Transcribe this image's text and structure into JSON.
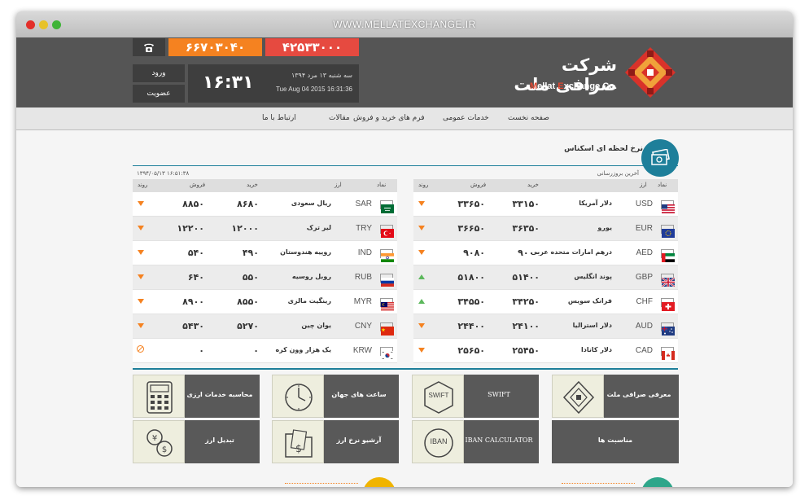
{
  "browser": {
    "url": "WWW.MELLATEXCHANGE.IR"
  },
  "header": {
    "logo_title": "شرکت صرافی ملت",
    "logo_sub_parts": [
      "M",
      "ellat ",
      "E",
      "xchange ",
      "Co."
    ],
    "phone_1": "۶۶۷۰۳۰۴۰",
    "phone_2": "۴۲۵۳۳۰۰۰",
    "login_label": "ورود",
    "signup_label": "عضویت",
    "clock_time": "۱۶:۳۱",
    "date_fa": "سه شنبه ۱۳ مرد ۱۳۹۴",
    "date_en": "Tue Aug 04 2015 16:31:36"
  },
  "menu": {
    "items": [
      "صفحه نخست",
      "خدمات عمومی",
      "فرم های خرید و فروش",
      "مقالات",
      "ارتباط با ما"
    ]
  },
  "rates": {
    "title": "نرخ لحظه ای اسکناس",
    "updated_label": "آخرین بروزرسانی",
    "date_stamp": "۱۳۹۴/۰۵/۱۳ ۱۶:۵۱:۳۸",
    "headers": {
      "symbol": "نماد",
      "currency": "ارز",
      "buy": "خرید",
      "sell": "فروش",
      "trend": "روند"
    },
    "right_rows": [
      {
        "flag": "US",
        "code": "USD",
        "name": "دلار آمریکا",
        "buy": "۳۳۱۵۰",
        "sell": "۳۳۶۵۰",
        "trend": "down"
      },
      {
        "flag": "EU",
        "code": "EUR",
        "name": "یورو",
        "buy": "۳۶۳۵۰",
        "sell": "۳۶۶۵۰",
        "trend": "down"
      },
      {
        "flag": "AE",
        "code": "AED",
        "name": "درهم امارات متحده عربی",
        "buy": "۹۰۰۰",
        "sell": "۹۰۸۰",
        "trend": "down"
      },
      {
        "flag": "GB",
        "code": "GBP",
        "name": "پوند انگلیس",
        "buy": "۵۱۴۰۰",
        "sell": "۵۱۸۰۰",
        "trend": "up"
      },
      {
        "flag": "CH",
        "code": "CHF",
        "name": "فرانک سویس",
        "buy": "۳۴۲۵۰",
        "sell": "۳۴۵۵۰",
        "trend": "up"
      },
      {
        "flag": "AU",
        "code": "AUD",
        "name": "دلار استرالیا",
        "buy": "۲۴۱۰۰",
        "sell": "۲۴۴۰۰",
        "trend": "down"
      },
      {
        "flag": "CA",
        "code": "CAD",
        "name": "دلار کانادا",
        "buy": "۲۵۴۵۰",
        "sell": "۲۵۶۵۰",
        "trend": "down"
      }
    ],
    "left_rows": [
      {
        "flag": "SA",
        "code": "SAR",
        "name": "ریال سعودی",
        "buy": "۸۶۸۰",
        "sell": "۸۸۵۰",
        "trend": "down"
      },
      {
        "flag": "TR",
        "code": "TRY",
        "name": "لیر ترک",
        "buy": "۱۲۰۰۰",
        "sell": "۱۲۲۰۰",
        "trend": "down"
      },
      {
        "flag": "IN",
        "code": "IND",
        "name": "روپیه هندوستان",
        "buy": "۴۹۰",
        "sell": "۵۴۰",
        "trend": "down"
      },
      {
        "flag": "RU",
        "code": "RUB",
        "name": "روبل روسیه",
        "buy": "۵۵۰",
        "sell": "۶۴۰",
        "trend": "down"
      },
      {
        "flag": "MY",
        "code": "MYR",
        "name": "رینگیت مالزی",
        "buy": "۸۵۵۰",
        "sell": "۸۹۰۰",
        "trend": "down"
      },
      {
        "flag": "CN",
        "code": "CNY",
        "name": "یوان چین",
        "buy": "۵۲۷۰",
        "sell": "۵۴۳۰",
        "trend": "down"
      },
      {
        "flag": "KR",
        "code": "KRW",
        "name": "یک هزار وون کره",
        "buy": "۰",
        "sell": "۰",
        "trend": "none"
      }
    ]
  },
  "tiles": {
    "calc": "محاسبه خدمات ارزی",
    "world_clock": "ساعت های جهان",
    "swift": "SWIFT",
    "swift_icon_text": "SWIFT",
    "about": "معرفی صرافی ملت",
    "convert": "تبدیل ارز",
    "archive": "آرشیو نرخ ارز",
    "iban": "IBAN CALCULATOR",
    "iban_icon_text": "IBAN",
    "occasions": "مناسبت ها"
  },
  "colors": {
    "accent": "#1e7f9a",
    "orange": "#f58220",
    "red": "#e64a40",
    "dark": "#555555"
  }
}
